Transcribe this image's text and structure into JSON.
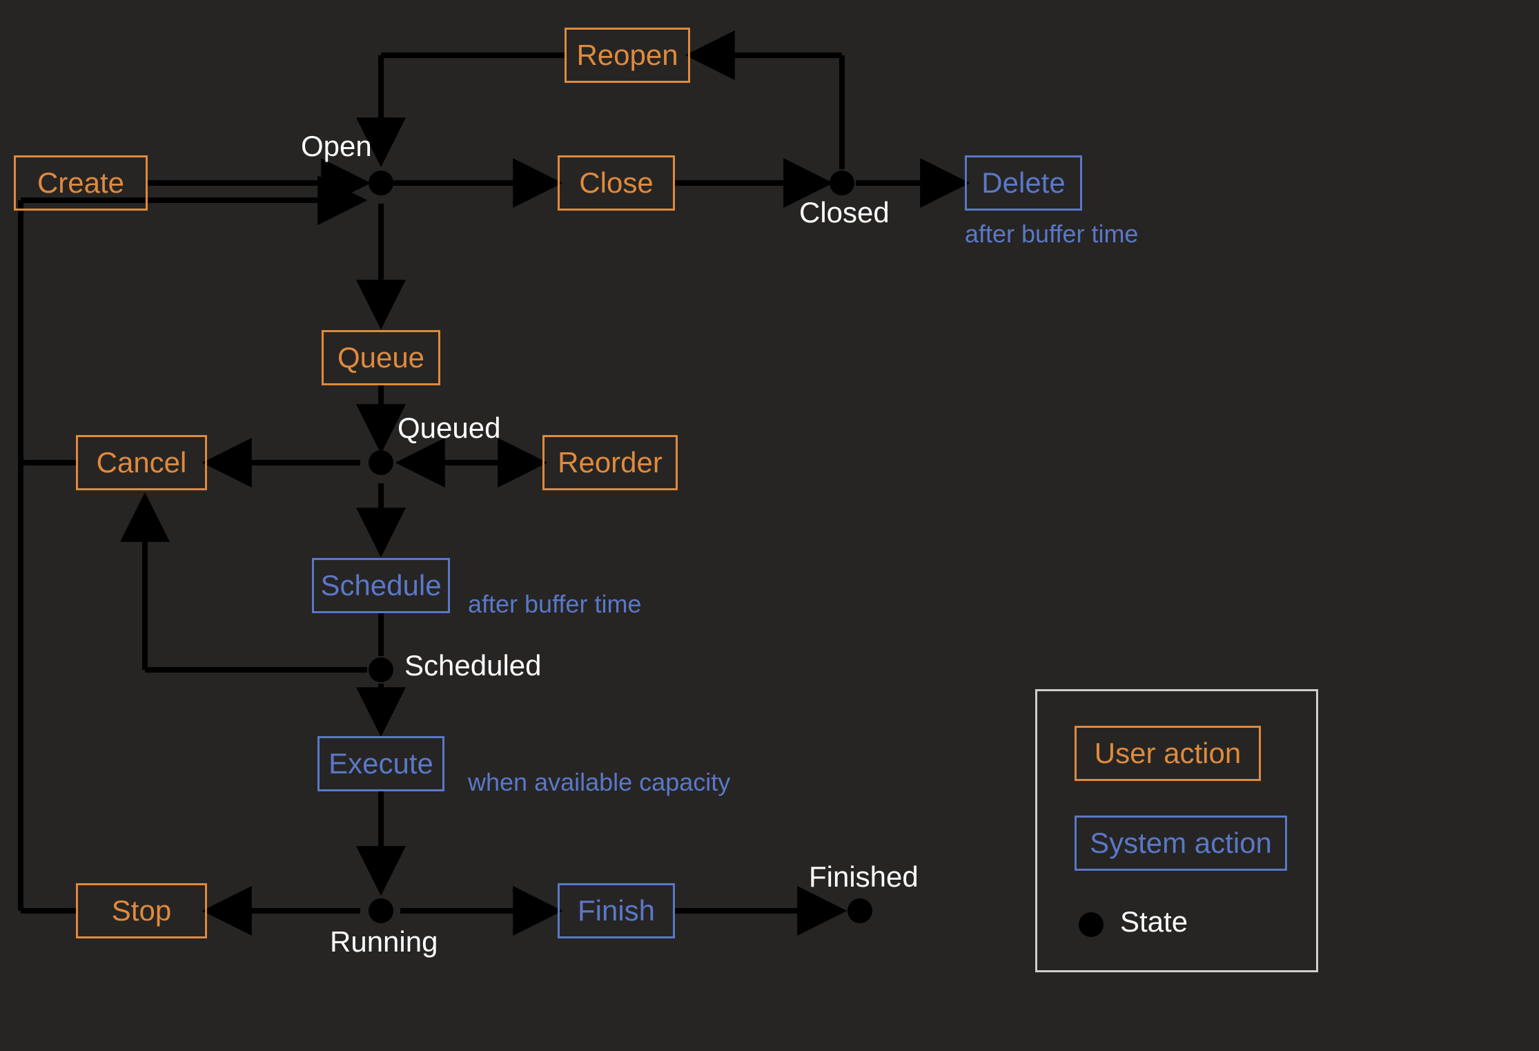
{
  "colors": {
    "bg": "#262524",
    "user": "#E08A3C",
    "system": "#5B78C7",
    "text": "#FFFFFF",
    "line": "#000000"
  },
  "actions": {
    "create": {
      "label": "Create",
      "type": "user"
    },
    "reopen": {
      "label": "Reopen",
      "type": "user"
    },
    "close": {
      "label": "Close",
      "type": "user"
    },
    "delete": {
      "label": "Delete",
      "type": "system"
    },
    "queue": {
      "label": "Queue",
      "type": "user"
    },
    "cancel": {
      "label": "Cancel",
      "type": "user"
    },
    "reorder": {
      "label": "Reorder",
      "type": "user"
    },
    "schedule": {
      "label": "Schedule",
      "type": "system"
    },
    "execute": {
      "label": "Execute",
      "type": "system"
    },
    "stop": {
      "label": "Stop",
      "type": "user"
    },
    "finish": {
      "label": "Finish",
      "type": "system"
    }
  },
  "states": {
    "open": {
      "label": "Open"
    },
    "closed": {
      "label": "Closed"
    },
    "queued": {
      "label": "Queued"
    },
    "scheduled": {
      "label": "Scheduled"
    },
    "running": {
      "label": "Running"
    },
    "finished": {
      "label": "Finished"
    }
  },
  "notes": {
    "delete_after": "after buffer time",
    "schedule_after": "after buffer time",
    "execute_when": "when available capacity"
  },
  "legend": {
    "user": "User action",
    "system": "System action",
    "state": "State"
  },
  "flow_description": "State machine: Create → Open. Open → Close → Closed → Delete (after buffer time). Closed → Reopen → Open. Open → Queue → Queued. Queued ↔ Reorder (self). Queued → Cancel → Open. Queued → Schedule (after buffer time) → Scheduled. Scheduled → Cancel. Scheduled → Execute (when available capacity) → Running. Running → Stop → Open. Running → Finish → Finished."
}
